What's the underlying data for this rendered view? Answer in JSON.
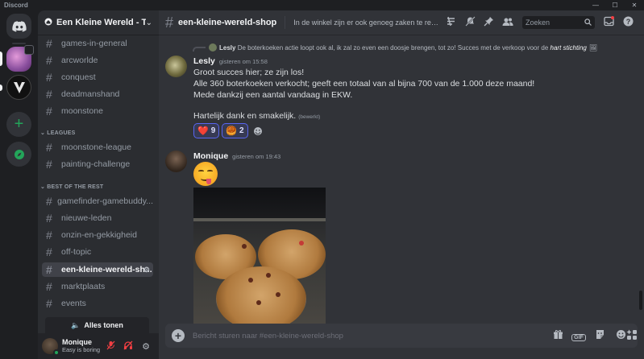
{
  "app": {
    "title": "Discord",
    "window_controls": [
      "—",
      "☐",
      "✕"
    ]
  },
  "rail": {
    "home_icon": "discord-logo-icon",
    "add_icon": "+",
    "explore_icon": "compass-icon"
  },
  "server": {
    "name": "Een Kleine Wereld - T...",
    "icon": "home-icon",
    "chevron": "⌄"
  },
  "channels": {
    "top": [
      "games-in-general",
      "arcworlde",
      "conquest",
      "deadmanshand",
      "moonstone"
    ],
    "categories": [
      {
        "label": "LEAGUES",
        "items": [
          "moonstone-league",
          "painting-challenge"
        ]
      },
      {
        "label": "BEST OF THE REST",
        "items": [
          "gamefinder-gamebuddy...",
          "nieuwe-leden",
          "onzin-en-gekkigheid",
          "off-topic",
          "een-kleine-wereld-sh...",
          "marktplaats",
          "events"
        ]
      }
    ],
    "active": "een-kleine-wereld-sh...",
    "show_all_label": "Alles tonen"
  },
  "user": {
    "name": "Monique",
    "status": "Easy is boring"
  },
  "header": {
    "channel_name": "een-kleine-wereld-shop",
    "topic": "In de winkel zijn er ook genoeg zaken te regelen of ...",
    "search_placeholder": "Zoeken"
  },
  "messages": {
    "reply": {
      "author": "Lesly",
      "text": "De boterkoeken actie loopt ook al, ik zal zo even een doosje brengen, tot zo!  Succes met de verkoop voor de ",
      "emphasis": "hart stichting"
    },
    "lesly": {
      "author": "Lesly",
      "timestamp": "gisteren om 15:58",
      "lines": [
        "Groot succes hier; ze zijn los!",
        "Alle 360 boterkoeken verkocht; geeft een totaal van al bijna 700 van de 1.000 deze maand!",
        "Mede dankzij een aantal vandaag in EKW.",
        "Hartelijk dank en smakelijk."
      ],
      "edited": "(bewerkt)",
      "reactions": [
        {
          "emoji": "❤️",
          "count": "9"
        },
        {
          "emoji": "🥮",
          "count": "2"
        }
      ]
    },
    "monique": {
      "author": "Monique",
      "timestamp": "gisteren om 19:43"
    }
  },
  "composer": {
    "placeholder": "Bericht sturen naar #een-kleine-wereld-shop"
  }
}
